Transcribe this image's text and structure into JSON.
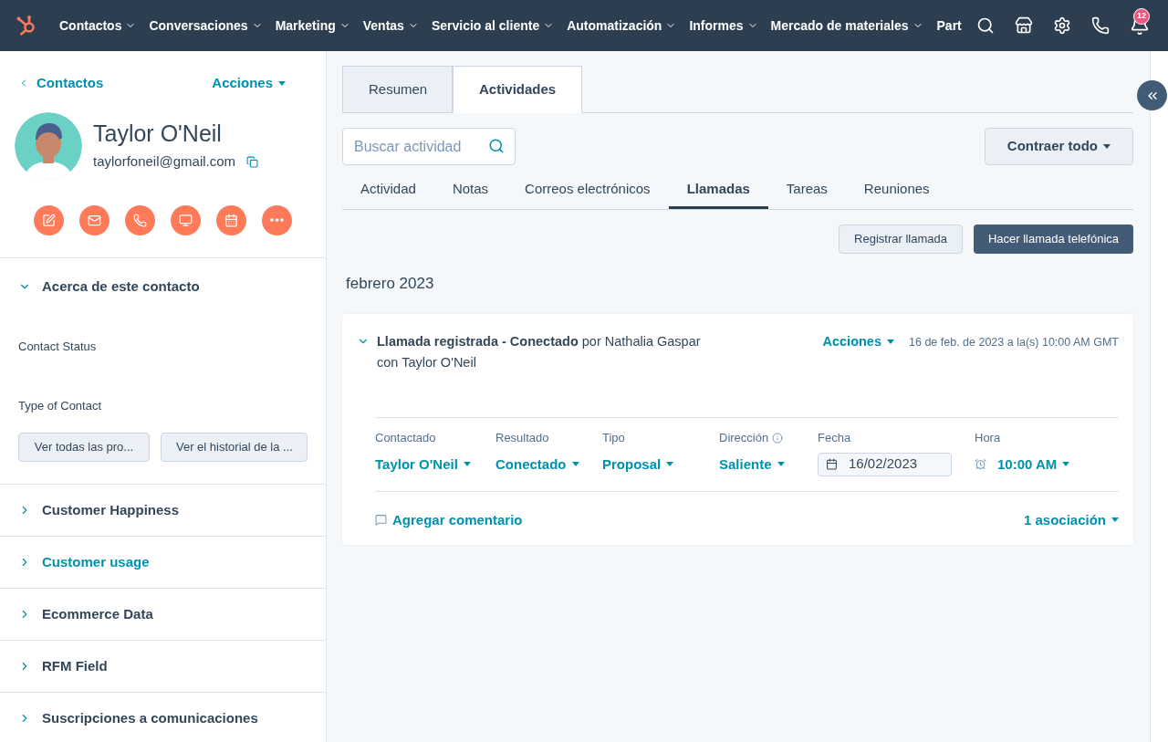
{
  "nav": {
    "items": [
      {
        "label": "Contactos"
      },
      {
        "label": "Conversaciones"
      },
      {
        "label": "Marketing"
      },
      {
        "label": "Ventas"
      },
      {
        "label": "Servicio al cliente"
      },
      {
        "label": "Automatización"
      },
      {
        "label": "Informes"
      },
      {
        "label": "Mercado de materiales"
      }
    ],
    "cut_item": "Part",
    "notification_count": "12"
  },
  "sidebar": {
    "back_link": "Contactos",
    "actions": "Acciones",
    "name": "Taylor O'Neil",
    "email": "taylorfoneil@gmail.com",
    "about": {
      "title": "Acerca de este contacto",
      "expanded": true,
      "fields": [
        "Contact Status",
        "Type of Contact"
      ],
      "buttons": [
        "Ver todas las pro...",
        "Ver el historial de la ..."
      ]
    },
    "sections": [
      {
        "title": "Customer Happiness",
        "highlighted": false
      },
      {
        "title": "Customer usage",
        "highlighted": true
      },
      {
        "title": "Ecommerce Data",
        "highlighted": false
      },
      {
        "title": "RFM Field",
        "highlighted": false
      },
      {
        "title": "Suscripciones a comunicaciones",
        "highlighted": false
      }
    ]
  },
  "main": {
    "tabs": [
      {
        "label": "Resumen",
        "selected": false
      },
      {
        "label": "Actividades",
        "selected": true
      }
    ],
    "search": {
      "placeholder": "Buscar actividad"
    },
    "collapse_button": "Contraer todo",
    "subtabs": [
      {
        "label": "Actividad",
        "selected": false
      },
      {
        "label": "Notas",
        "selected": false
      },
      {
        "label": "Correos electrónicos",
        "selected": false
      },
      {
        "label": "Llamadas",
        "selected": true
      },
      {
        "label": "Tareas",
        "selected": false
      },
      {
        "label": "Reuniones",
        "selected": false
      }
    ],
    "buttons": [
      "Registrar llamada",
      "Hacer llamada telefónica"
    ],
    "month": "febrero 2023",
    "call": {
      "title": "**Llamada registrada - Conectado** por Nathalia Gaspar",
      "subtitle": "con Taylor O'Neil",
      "actions": "Acciones",
      "timestamp": "16 de feb. de 2023 a la(s) 10:00 AM GMT",
      "fields": [
        {
          "label": "Contactado",
          "value": "Taylor O'Neil",
          "kind": "dropdown"
        },
        {
          "label": "Resultado",
          "value": "Conectado",
          "kind": "dropdown"
        },
        {
          "label": "Tipo",
          "value": "Proposal",
          "kind": "dropdown"
        },
        {
          "label": "Dirección",
          "value": "Saliente",
          "kind": "dropdown",
          "info": true
        },
        {
          "label": "Fecha",
          "value": "16/02/2023",
          "kind": "date"
        },
        {
          "label": "Hora",
          "value": "10:00 AM",
          "kind": "time"
        }
      ],
      "comment": "Agregar comentario",
      "associations": "1 asociación"
    }
  }
}
